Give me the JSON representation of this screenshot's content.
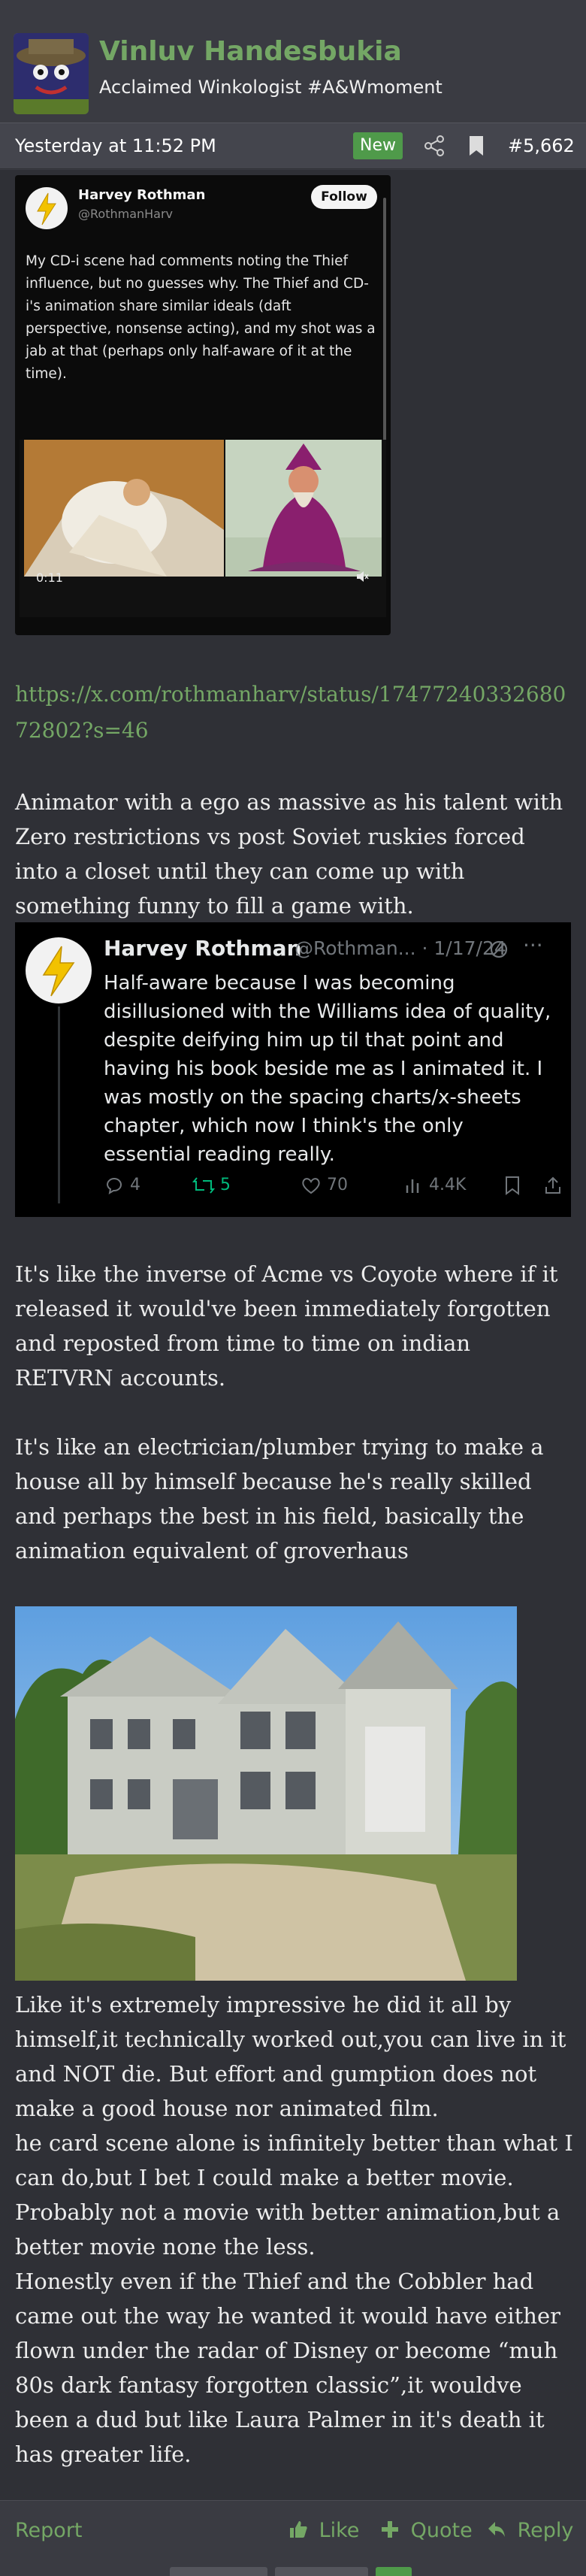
{
  "user": {
    "name": "Vinluv Handesbukia",
    "title": "Acclaimed Winkologist #A&Wmoment"
  },
  "post_meta": {
    "time": "Yesterday at 11:52 PM",
    "badge": "New",
    "number": "#5,662"
  },
  "embed1": {
    "name": "Harvey Rothman",
    "handle": "@RothmanHarv",
    "follow_label": "Follow",
    "text": "My CD-i scene had comments noting the Thief influence, but no guesses why. The Thief and CD-i's animation share similar ideals (daft perspective, nonsense acting), and my shot was a jab at that (perhaps only half-aware of it at the time).",
    "video_time": "0:11"
  },
  "link": "https://x.com/rothmanharv/status/1747724033268072802?s=46",
  "paragraph1": "Animator with a ego as massive as his talent with Zero restrictions vs post Soviet ruskies forced into a closet until they can come up with something funny to fill a game with.",
  "embed2": {
    "name": "Harvey Rothman",
    "handle_date": "@Rothman... · 1/17/24",
    "more": "···",
    "text": "Half-aware because I was becoming disillusioned with the Williams idea of quality, despite deifying him up til that point and having his book beside me as I animated it. I was mostly on the spacing charts/x-sheets chapter, which now I think's the only essential reading really.",
    "replies": "4",
    "retweets": "5",
    "likes": "70",
    "views": "4.4K"
  },
  "paragraph2": "It's like the inverse of Acme vs Coyote where if it released it would've been immediately forgotten and reposted from time to time on indian RETVRN accounts.",
  "paragraph3": "It's like an electrician/plumber trying to make a house all by himself because he's really skilled and perhaps the best in his field, basically the animation equivalent of groverhaus",
  "paragraph4": "Like it's extremely impressive he did it all by himself,it technically worked out,you can live in it and NOT die. But effort and gumption does not make a good house nor animated film.",
  "paragraph5": "he card scene alone is infinitely better than what I can do,but I bet I could make a better movie. Probably not a movie with better animation,but a better movie none the less.",
  "paragraph6": "Honestly even if the Thief and the Cobbler had came out the way he wanted it would have either flown under the radar of Disney or become “muh 80s dark fantasy forgotten classic”,it wouldve been a dud but like Laura Palmer in it's death it has greater life.",
  "footer": {
    "report": "Report",
    "like": "Like",
    "quote": "Quote",
    "reply": "Reply"
  },
  "colors": {
    "accent_green": "#74a765",
    "badge_green": "#4f9a4a",
    "page_bg": "#2f3036",
    "header_bg": "#3a3b42"
  }
}
